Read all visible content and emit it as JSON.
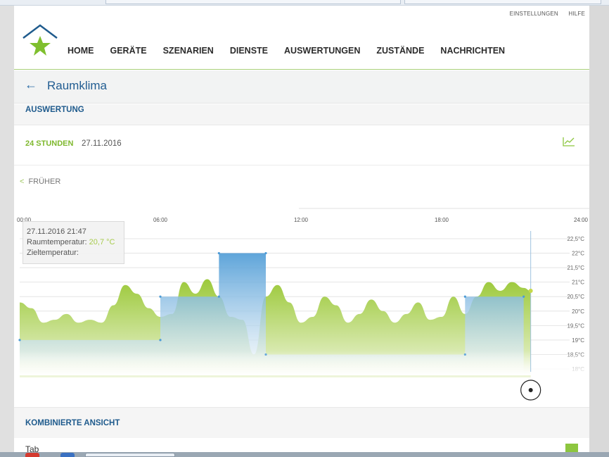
{
  "header": {
    "util_links": [
      "EINSTELLUNGEN",
      "HILFE"
    ],
    "nav": [
      "HOME",
      "GERÄTE",
      "SZENARIEN",
      "DIENSTE",
      "AUSWERTUNGEN",
      "ZUSTÄNDE",
      "NACHRICHTEN"
    ]
  },
  "page": {
    "title": "Raumklima",
    "section": "AUSWERTUNG",
    "range_label": "24 STUNDEN",
    "range_date": "27.11.2016",
    "earlier_label": "FRÜHER",
    "combined_label": "KOMBINIERTE ANSICHT",
    "bottom_text": "Tab"
  },
  "tooltip": {
    "datetime": "27.11.2016 21:47",
    "temp_label": "Raumtemperatur:",
    "temp_value": "20,7 °C",
    "target_label": "Zieltemperatur:"
  },
  "colors": {
    "brand_blue": "#1f5b8d",
    "brand_green": "#8dc63f",
    "actual_series": "#a7cb4b",
    "target_series": "#4d9bd6"
  },
  "chart_data": {
    "type": "area",
    "x_ticks": [
      "00:00",
      "06:00",
      "12:00",
      "18:00",
      "24:00"
    ],
    "y_ticks": [
      "22,5°C",
      "22°C",
      "21,5°C",
      "21°C",
      "20,5°C",
      "20°C",
      "19,5°C",
      "19°C",
      "18,5°C",
      "18°C"
    ],
    "ylim": [
      18,
      22.5
    ],
    "xlim_hours": [
      0,
      24
    ],
    "series": [
      {
        "name": "Raumtemperatur",
        "x_hours": [
          0,
          0.5,
          1.0,
          1.5,
          2.0,
          2.5,
          3.0,
          3.5,
          4.0,
          4.5,
          5.0,
          5.5,
          6.0,
          6.5,
          7.0,
          7.5,
          8.0,
          8.5,
          9.0,
          9.5,
          10.0,
          10.5,
          11.0,
          11.5,
          12.0,
          12.5,
          13.0,
          13.5,
          14.0,
          14.5,
          15.0,
          15.5,
          16.0,
          16.5,
          17.0,
          17.5,
          18.0,
          18.5,
          19.0,
          19.5,
          20.0,
          20.5,
          21.0,
          21.5,
          21.8
        ],
        "values": [
          20.3,
          20.1,
          19.6,
          19.7,
          19.9,
          19.6,
          19.7,
          19.6,
          20.2,
          20.9,
          20.6,
          20.1,
          19.8,
          19.9,
          21.0,
          20.6,
          21.1,
          20.5,
          19.8,
          19.7,
          18.5,
          20.5,
          20.9,
          20.3,
          19.6,
          19.8,
          20.5,
          20.2,
          19.6,
          19.9,
          20.4,
          20.0,
          19.6,
          19.9,
          20.3,
          19.7,
          19.8,
          20.5,
          19.9,
          20.5,
          21.0,
          20.7,
          21.0,
          20.8,
          20.7
        ]
      },
      {
        "name": "Zieltemperatur",
        "x_hours": [
          0,
          6.0,
          6.0,
          8.5,
          8.5,
          10.5,
          10.5,
          19.0,
          19.0,
          21.5
        ],
        "values": [
          19.0,
          19.0,
          20.5,
          20.5,
          22.0,
          22.0,
          18.5,
          18.5,
          20.5,
          20.5
        ]
      }
    ],
    "cursor_hour": 21.8,
    "grid": true
  }
}
